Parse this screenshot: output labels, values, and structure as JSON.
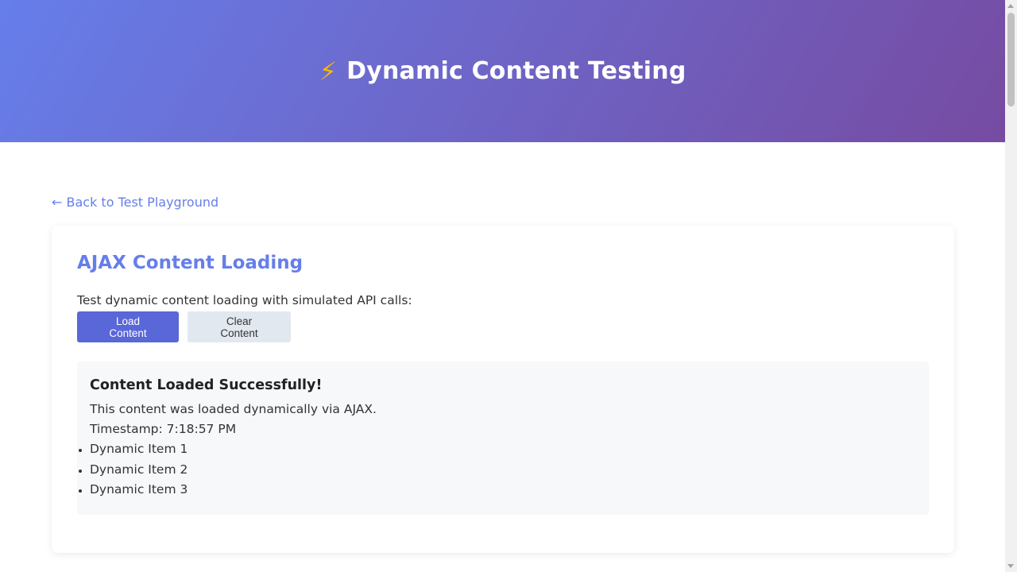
{
  "header": {
    "icon": "lightning-bolt-icon",
    "icon_glyph": "⚡",
    "title": "Dynamic Content Testing",
    "gradient_start": "#667eea",
    "gradient_end": "#764ba2"
  },
  "nav": {
    "back_link": "← Back to Test Playground"
  },
  "card": {
    "title": "AJAX Content Loading",
    "description": "Test dynamic content loading with simulated API calls:",
    "buttons": {
      "load": "Load Content",
      "clear": "Clear Content"
    },
    "result": {
      "heading": "Content Loaded Successfully!",
      "message": "This content was loaded dynamically via AJAX.",
      "timestamp": "Timestamp: 7:18:57 PM",
      "items": [
        "Dynamic Item 1",
        "Dynamic Item 2",
        "Dynamic Item 3"
      ]
    }
  },
  "colors": {
    "accent": "#667eea",
    "primary_button": "#5a67d8",
    "secondary_button": "#e2e8f0"
  }
}
